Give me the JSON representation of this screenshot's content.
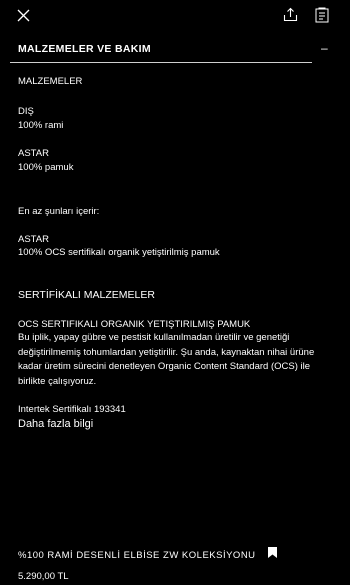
{
  "toolbar": {
    "close_icon": "close-icon",
    "share_icon": "share-icon",
    "size_guide_icon": "size-guide-icon"
  },
  "section": {
    "title": "MALZEMELER VE BAKIM",
    "toggle": "–"
  },
  "materials": {
    "heading": "MALZEMELER",
    "outer_label": "DIŞ",
    "outer_value": "100% rami",
    "lining_label": "ASTAR",
    "lining_value": "100% pamuk",
    "contains_label": "En az şunları içerir:",
    "contains_lining_label": "ASTAR",
    "contains_lining_value": "100% OCS sertifikalı organik yetiştirilmiş pamuk"
  },
  "certified": {
    "heading": "SERTİFİKALI MALZEMELER",
    "subheading": "OCS SERTIFIKALI ORGANIK YETIŞTIRILMIŞ PAMUK",
    "description": "Bu iplik, yapay gübre ve pestisit kullanılmadan üretilir ve genetiği değiştirilmemiş tohumlardan yetiştirilir. Şu anda, kaynaktan nihai ürüne kadar üretim sürecini denetleyen Organic Content Standard (OCS) ile birlikte çalışıyoruz.",
    "certificate": "Intertek Sertifikalı 193341",
    "more_info": "Daha fazla bilgi"
  },
  "product": {
    "name": "%100 RAMİ DESENLİ ELBİSE ZW KOLEKSİYONU",
    "price": "5.290,00 TL",
    "bookmark_icon": "bookmark-icon"
  }
}
